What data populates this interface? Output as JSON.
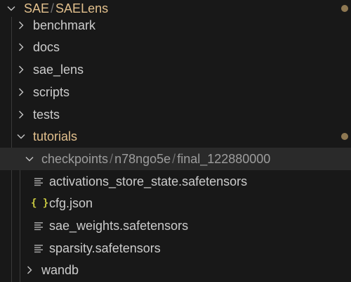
{
  "explorer": {
    "root": {
      "label_parts": [
        "SAE",
        "/",
        "SAELens"
      ],
      "expanded": true,
      "modified": true
    },
    "folders": [
      {
        "label": "benchmark",
        "expanded": false
      },
      {
        "label": "docs",
        "expanded": false
      },
      {
        "label": "sae_lens",
        "expanded": false
      },
      {
        "label": "scripts",
        "expanded": false
      },
      {
        "label": "tests",
        "expanded": false
      },
      {
        "label": "tutorials",
        "expanded": true,
        "modified": true
      }
    ],
    "checkpoint_path": {
      "parts": [
        "checkpoints",
        "/",
        "n78ngo5e",
        "/",
        "final_122880000"
      ],
      "expanded": true,
      "selected": true
    },
    "files": [
      {
        "label": "activations_store_state.safetensors",
        "icon": "lines-file-icon"
      },
      {
        "label": "cfg.json",
        "icon": "json-braces-icon",
        "icon_text": "{ }"
      },
      {
        "label": "sae_weights.safetensors",
        "icon": "lines-file-icon"
      },
      {
        "label": "sparsity.safetensors",
        "icon": "lines-file-icon"
      }
    ],
    "wandb": {
      "label": "wandb",
      "expanded": false
    }
  },
  "colors": {
    "background": "#181818",
    "selected_row": "#2a2a2a",
    "modified_text": "#e2c08d",
    "modified_dot": "#8e7852",
    "json_icon": "#cbcb41",
    "text": "#cccccc",
    "dim_text": "#9d9d9d"
  }
}
